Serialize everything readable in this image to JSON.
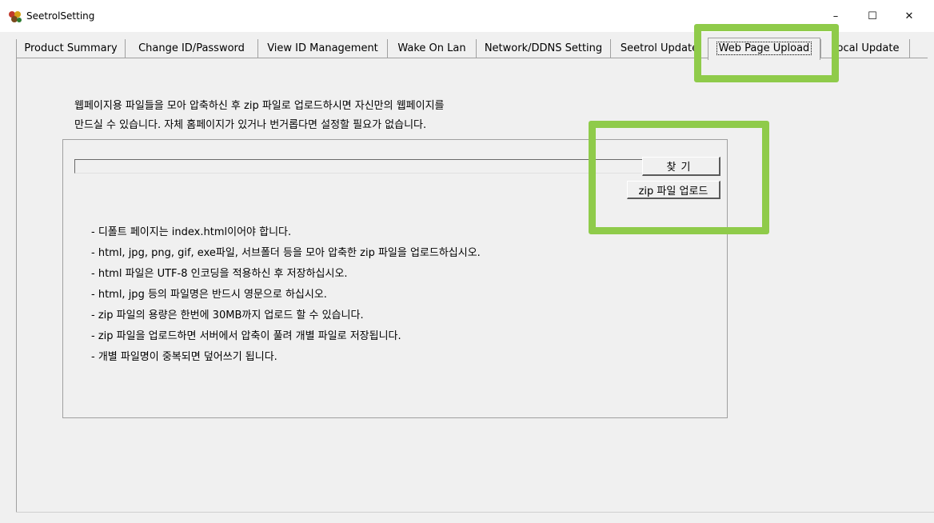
{
  "window": {
    "title": "SeetrolSetting",
    "app_icon": "puzzle-app-icon",
    "controls": {
      "minimize": "–",
      "maximize": "☐",
      "close": "✕"
    }
  },
  "tabs": [
    {
      "label": "Product Summary"
    },
    {
      "label": "Change ID/Password"
    },
    {
      "label": "View ID Management"
    },
    {
      "label": "Wake On Lan"
    },
    {
      "label": "Network/DDNS Setting"
    },
    {
      "label": "Seetrol Update"
    },
    {
      "label": "Web Page Upload",
      "selected": true
    },
    {
      "label": "Local Update"
    }
  ],
  "description": {
    "line1": "웹페이지용 파일들을 모아 압축하신 후  zip 파일로 업로드하시면 자신만의 웹페이지를",
    "line2": "만드실 수 있습니다. 자체 홈페이지가 있거나 번거롭다면 설정할 필요가 없습니다."
  },
  "upload": {
    "file_path_value": "",
    "find_button": "찾기",
    "upload_button": "zip 파일 업로드"
  },
  "rules": [
    "- 디폴트 페이지는 index.html이어야 합니다.",
    "- html, jpg, png, gif, exe파일, 서브폴더 등을 모아 압축한 zip 파일을 업로드하십시오.",
    "- html 파일은 UTF-8 인코딩을 적용하신 후 저장하십시오.",
    "- html, jpg 등의 파일명은 반드시 영문으로 하십시오.",
    "- zip 파일의 용량은 한번에 30MB까지 업로드 할 수 있습니다.",
    "- zip 파일을 업로드하면 서버에서 압축이 풀려 개별 파일로 저장됩니다.",
    "- 개별 파일명이 중복되면 덮어쓰기 됩니다."
  ],
  "annotations": {
    "highlight_color": "#8fcb4a"
  }
}
